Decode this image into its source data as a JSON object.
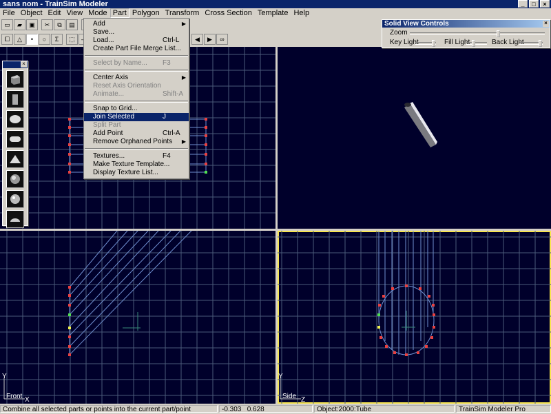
{
  "window": {
    "title": "sans nom - TrainSim Modeler"
  },
  "menubar": [
    "File",
    "Object",
    "Edit",
    "View",
    "Mode",
    "Part",
    "Polygon",
    "Transform",
    "Cross Section",
    "Template",
    "Help"
  ],
  "part_menu": {
    "items": [
      {
        "label": "Add",
        "shortcut": "",
        "submenu": true,
        "disabled": false,
        "highlighted": false
      },
      {
        "label": "Save...",
        "shortcut": "",
        "submenu": false,
        "disabled": false,
        "highlighted": false
      },
      {
        "label": "Load...",
        "shortcut": "Ctrl-L",
        "submenu": false,
        "disabled": false,
        "highlighted": false
      },
      {
        "label": "Create Part File Merge List...",
        "shortcut": "",
        "submenu": false,
        "disabled": false,
        "highlighted": false
      },
      {
        "separator": true
      },
      {
        "label": "Select by Name...",
        "shortcut": "F3",
        "submenu": false,
        "disabled": true,
        "highlighted": false
      },
      {
        "separator": true
      },
      {
        "label": "Center Axis",
        "shortcut": "",
        "submenu": true,
        "disabled": false,
        "highlighted": false
      },
      {
        "label": "Reset Axis Orientation",
        "shortcut": "",
        "submenu": false,
        "disabled": true,
        "highlighted": false
      },
      {
        "label": "Animate...",
        "shortcut": "Shift-A",
        "submenu": false,
        "disabled": true,
        "highlighted": false
      },
      {
        "separator": true
      },
      {
        "label": "Snap to Grid...",
        "shortcut": "",
        "submenu": false,
        "disabled": false,
        "highlighted": false
      },
      {
        "label": "Join Selected",
        "shortcut": "J",
        "submenu": false,
        "disabled": false,
        "highlighted": true
      },
      {
        "label": "Split Part",
        "shortcut": "",
        "submenu": false,
        "disabled": true,
        "highlighted": false
      },
      {
        "label": "Add Point",
        "shortcut": "Ctrl-A",
        "submenu": false,
        "disabled": false,
        "highlighted": false
      },
      {
        "label": "Remove Orphaned Points",
        "shortcut": "",
        "submenu": true,
        "disabled": false,
        "highlighted": false
      },
      {
        "separator": true
      },
      {
        "label": "Textures...",
        "shortcut": "F4",
        "submenu": false,
        "disabled": false,
        "highlighted": false
      },
      {
        "label": "Make Texture Template...",
        "shortcut": "",
        "submenu": false,
        "disabled": false,
        "highlighted": false
      },
      {
        "label": "Display Texture List...",
        "shortcut": "",
        "submenu": false,
        "disabled": false,
        "highlighted": false
      }
    ]
  },
  "solid_view": {
    "title": "Solid View Controls",
    "zoom_label": "Zoom",
    "key_light_label": "Key Light",
    "fill_light_label": "Fill Light",
    "back_light_label": "Back Light"
  },
  "viewports": {
    "front": {
      "label": "Front",
      "axis_y": "Y",
      "axis_x": "X"
    },
    "side": {
      "label": "Side",
      "axis_y": "Y",
      "axis_z": "Z"
    }
  },
  "statusbar": {
    "hint": "Combine all selected parts or points into the current part/point",
    "coord_x": "-0.303",
    "coord_y": "0.628",
    "object": "Object:2000:Tube",
    "app": "TrainSim Modeler Pro"
  },
  "colors": {
    "viewport_bg": "#00002b",
    "grid": "#4a5a7a",
    "wire": "#6f8fd0",
    "point": "#e84040",
    "active_border": "#f6e44f"
  }
}
